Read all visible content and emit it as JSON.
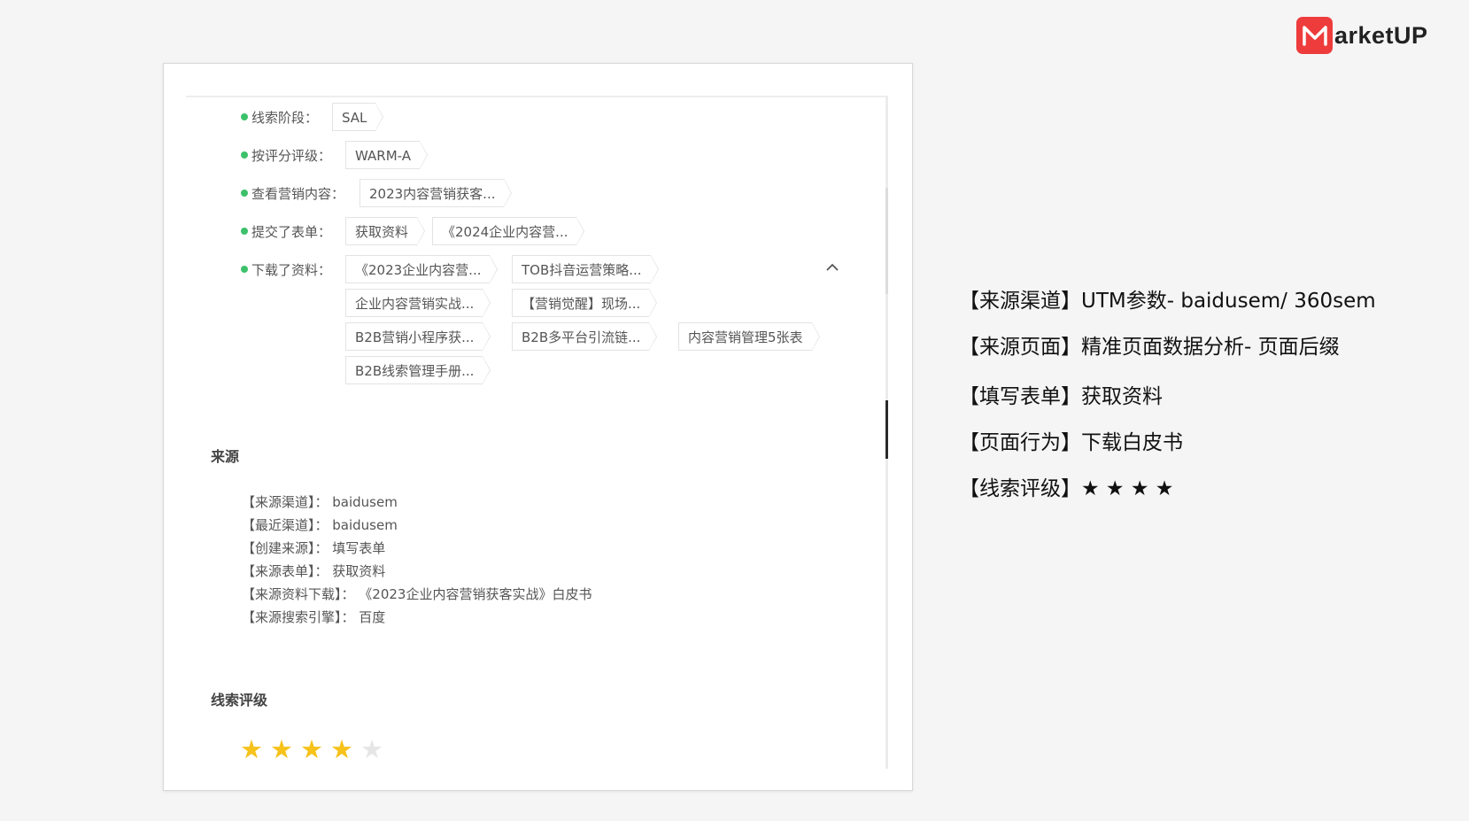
{
  "logo": {
    "text": "arketUP",
    "mark_icon": "m-logo-icon",
    "mark_color": "#ee3c3c"
  },
  "lead_info": {
    "rows": [
      {
        "label": "线索阶段：",
        "tags": [
          "SAL"
        ]
      },
      {
        "label": "按评分评级：",
        "tags": [
          "WARM-A"
        ]
      },
      {
        "label": "查看营销内容：",
        "tags": [
          "2023内容营销获客..."
        ]
      },
      {
        "label": "提交了表单：",
        "tags": [
          "获取资料",
          "《2024企业内容营..."
        ]
      },
      {
        "label": "下载了资料：",
        "tags": [
          "《2023企业内容营...",
          "TOB抖音运营策略...",
          "企业内容营销实战...",
          "【营销觉醒】现场...",
          "B2B营销小程序获...",
          "B2B多平台引流链...",
          "内容营销管理5张表",
          "B2B线索管理手册..."
        ]
      }
    ],
    "status_dot_color": "#3cc16a"
  },
  "source_section": {
    "title": "来源",
    "lines": [
      "【来源渠道】： baidusem",
      "【最近渠道】： baidusem",
      "【创建来源】： 填写表单",
      "【来源表单】： 获取资料",
      "【来源资料下载】： 《2023企业内容营销获客实战》白皮书",
      "【来源搜索引擎】： 百度"
    ]
  },
  "rating_section": {
    "title": "线索评级",
    "rating": 4,
    "max": 5,
    "star_color": "#f6c21b"
  },
  "annotations": [
    "【来源渠道】UTM参数- baidusem/ 360sem",
    "【来源页面】精准页面数据分析- 页面后缀",
    "【填写表单】获取资料",
    "【页面行为】下载白皮书",
    "【线索评级】★ ★ ★ ★"
  ]
}
